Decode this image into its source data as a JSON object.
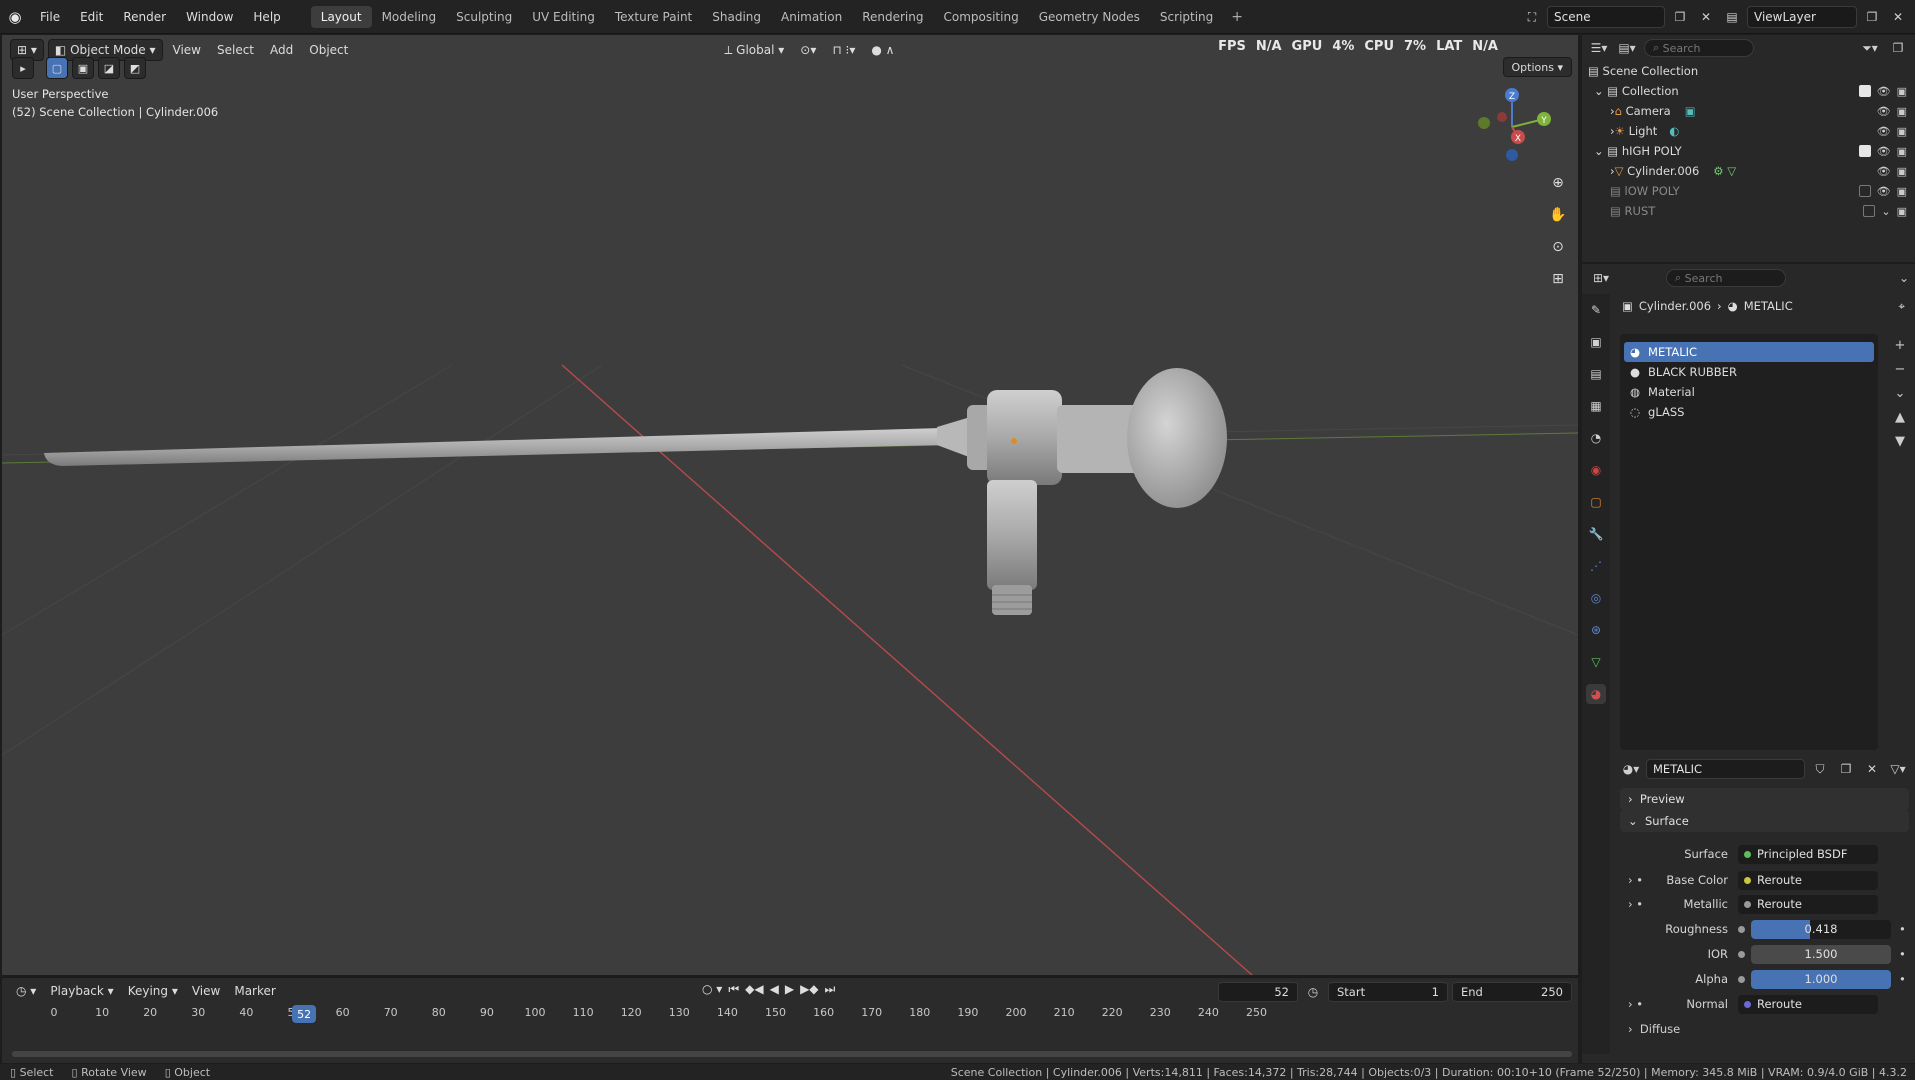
{
  "menu": [
    "File",
    "Edit",
    "Render",
    "Window",
    "Help"
  ],
  "workspaces": [
    "Layout",
    "Modeling",
    "Sculpting",
    "UV Editing",
    "Texture Paint",
    "Shading",
    "Animation",
    "Rendering",
    "Compositing",
    "Geometry Nodes",
    "Scripting"
  ],
  "active_workspace": "Layout",
  "scene": {
    "name": "Scene",
    "view_layer": "ViewLayer"
  },
  "viewport": {
    "mode": "Object Mode",
    "menus": [
      "View",
      "Select",
      "Add",
      "Object"
    ],
    "orientation": "Global",
    "perspective": "User Perspective",
    "collection_info": "(52) Scene Collection | Cylinder.006",
    "perf": {
      "fps": "FPS",
      "fps_val": "N/A",
      "gpu": "GPU",
      "gpu_val": "4%",
      "cpu": "CPU",
      "cpu_val": "7%",
      "lat": "LAT",
      "lat_val": "N/A"
    },
    "options": "Options",
    "gizmo": {
      "z": "Z",
      "y": "Y",
      "x": "X"
    }
  },
  "timeline": {
    "menus": [
      "Playback",
      "Keying",
      "View",
      "Marker"
    ],
    "current_frame": "52",
    "start_label": "Start",
    "start": "1",
    "end_label": "End",
    "end": "250",
    "ticks": [
      "0",
      "10",
      "20",
      "30",
      "40",
      "50",
      "60",
      "70",
      "80",
      "90",
      "100",
      "110",
      "120",
      "130",
      "140",
      "150",
      "160",
      "170",
      "180",
      "190",
      "200",
      "210",
      "220",
      "230",
      "240",
      "250"
    ]
  },
  "status": {
    "select": "Select",
    "rotate": "Rotate View",
    "object": "Object",
    "info": "Scene Collection | Cylinder.006 | Verts:14,811 | Faces:14,372 | Tris:28,744 | Objects:0/3 | Duration: 00:10+10 (Frame 52/250) | Memory: 345.8 MiB | VRAM: 0.9/4.0 GiB | 4.3.2"
  },
  "outliner": {
    "search_placeholder": "Search",
    "root": "Scene Collection",
    "items": [
      {
        "label": "Collection",
        "depth": 1
      },
      {
        "label": "Camera",
        "depth": 2
      },
      {
        "label": "Light",
        "depth": 2
      },
      {
        "label": "hIGH POLY",
        "depth": 1
      },
      {
        "label": "Cylinder.006",
        "depth": 2
      },
      {
        "label": "lOW POLY",
        "depth": 1
      },
      {
        "label": "RUST",
        "depth": 1
      }
    ]
  },
  "properties": {
    "search_placeholder": "Search",
    "object": "Cylinder.006",
    "material": "METALIC",
    "slots": [
      "METALIC",
      "BLACK RUBBER",
      "Material",
      "gLASS"
    ],
    "active_material": "METALIC",
    "panels": {
      "preview": "Preview",
      "surface": "Surface",
      "diffuse": "Diffuse"
    },
    "surface": {
      "surface_label": "Surface",
      "surface_value": "Principled BSDF",
      "base_color_label": "Base Color",
      "base_color_value": "Reroute",
      "metallic_label": "Metallic",
      "metallic_value": "Reroute",
      "roughness_label": "Roughness",
      "roughness_value": "0.418",
      "roughness_fill": 0.418,
      "ior_label": "IOR",
      "ior_value": "1.500",
      "alpha_label": "Alpha",
      "alpha_value": "1.000",
      "alpha_fill": 1.0,
      "normal_label": "Normal",
      "normal_value": "Reroute"
    }
  },
  "colors": {
    "accent": "#4772b3",
    "x_axis": "#c94b4b",
    "y_axis": "#7fb33a",
    "z_axis": "#4a7bd0"
  }
}
